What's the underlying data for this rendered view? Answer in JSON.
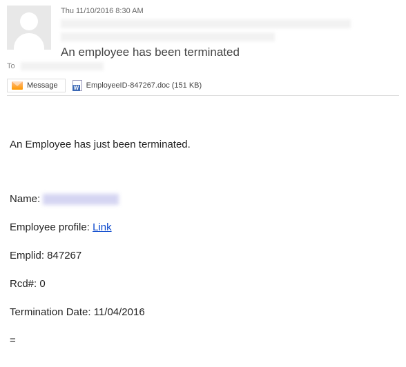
{
  "header": {
    "timestamp": "Thu 11/10/2016 8:30 AM",
    "subject": "An employee has been terminated"
  },
  "to_label": "To",
  "tabs": {
    "message_label": "Message"
  },
  "attachment": {
    "filename_display": "EmployeeID-847267.doc (151 KB)"
  },
  "body": {
    "intro": "An Employee has just been terminated.",
    "name_label": "Name: ",
    "profile_label": "Employee profile: ",
    "profile_link_text": "Link",
    "emplid": "Emplid: 847267",
    "rcd": "Rcd#: 0",
    "term_date": "Termination Date: 11/04/2016",
    "equals_line": "="
  }
}
